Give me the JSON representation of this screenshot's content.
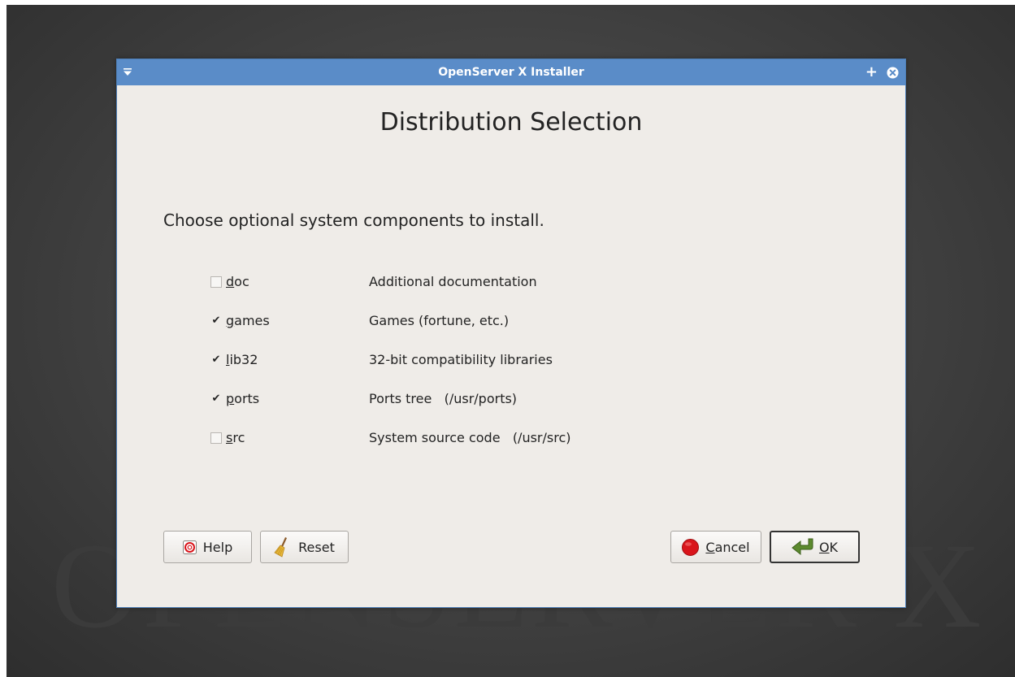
{
  "background": {
    "watermark": "OPENSERVER X"
  },
  "window": {
    "title": "OpenServer X Installer",
    "heading": "Distribution Selection",
    "prompt": "Choose optional system components to install."
  },
  "options": [
    {
      "name_mnemonic": "d",
      "name_rest": "oc",
      "description": "Additional documentation",
      "checked": false
    },
    {
      "name_mnemonic": "g",
      "name_rest": "ames",
      "description": "Games (fortune, etc.)",
      "checked": true
    },
    {
      "name_mnemonic": "l",
      "name_rest": "ib32",
      "description": "32-bit compatibility libraries",
      "checked": true
    },
    {
      "name_mnemonic": "p",
      "name_rest": "orts",
      "description": "Ports tree   (/usr/ports)",
      "checked": true
    },
    {
      "name_mnemonic": "s",
      "name_rest": "rc",
      "description": "System source code   (/usr/src)",
      "checked": false
    }
  ],
  "buttons": {
    "help": {
      "label": "Help",
      "icon": "lifebuoy-icon"
    },
    "reset": {
      "label": "Reset",
      "icon": "broom-icon"
    },
    "cancel": {
      "mnemonic": "C",
      "rest": "ancel",
      "icon": "stop-icon"
    },
    "ok": {
      "mnemonic": "O",
      "rest": "K",
      "icon": "arrow-return-icon"
    }
  },
  "colors": {
    "titlebar": "#5a8cc8",
    "window_bg": "#efece8",
    "stop_red": "#d9151b",
    "ok_arrow_green": "#5c8a2e"
  },
  "check_glyph": "✔"
}
